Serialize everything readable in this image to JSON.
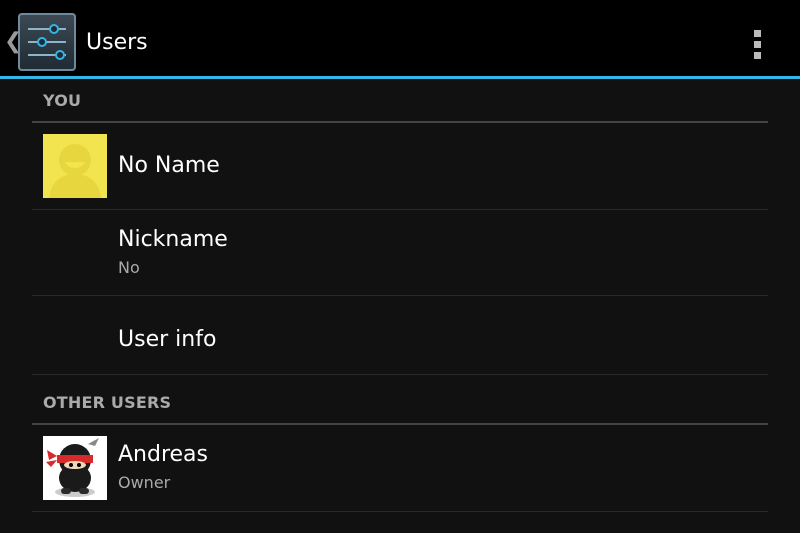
{
  "action_bar": {
    "title": "Users",
    "up_icon": "chevron-left-icon",
    "app_icon": "settings-sliders-icon",
    "overflow_icon": "overflow-menu-icon",
    "accent_color": "#33b5e5"
  },
  "sections": {
    "you": {
      "header": "YOU",
      "profile": {
        "name": "No Name",
        "avatar": "default-user-avatar",
        "avatar_color": "#f2e44e"
      },
      "nickname": {
        "label": "Nickname",
        "value": "No"
      },
      "user_info": {
        "label": "User info"
      }
    },
    "other_users": {
      "header": "OTHER USERS",
      "users": [
        {
          "name": "Andreas",
          "role": "Owner",
          "avatar": "ninja-avatar"
        }
      ]
    }
  }
}
